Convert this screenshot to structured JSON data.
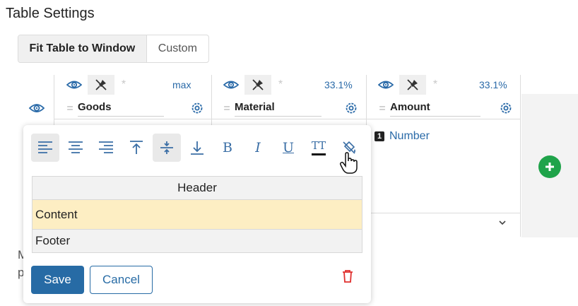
{
  "page": {
    "title": "Table Settings"
  },
  "mode": {
    "fit_label": "Fit Table to Window",
    "custom_label": "Custom",
    "selected": "fit"
  },
  "columns": [
    {
      "name": "Goods",
      "width": "max"
    },
    {
      "name": "Material",
      "width": "33.1%"
    },
    {
      "name": "Amount",
      "width": "33.1%"
    }
  ],
  "column_toolbar": {
    "icons": [
      "eye-icon",
      "pin-off-icon",
      "asterisk-icon"
    ],
    "asterisk": "*"
  },
  "column_head": {
    "drag_glyph": "=",
    "settings_icon": "gear-icon"
  },
  "cells": {
    "number_badge": "1",
    "number_label": "Number"
  },
  "notes": {
    "line1": "M",
    "line2": "p"
  },
  "format_toolbar": {
    "buttons": [
      "align-left-icon",
      "align-center-icon",
      "align-right-icon",
      "align-top-icon",
      "align-middle-icon",
      "align-bottom-icon",
      "bold-icon",
      "italic-icon",
      "underline-icon",
      "text-color-icon",
      "fill-color-icon"
    ],
    "bold": "B",
    "italic": "I",
    "underline": "U",
    "text_size": "TT",
    "active": [
      "align-left",
      "align-middle"
    ]
  },
  "sections": {
    "header": "Header",
    "content": "Content",
    "footer": "Footer"
  },
  "actions": {
    "save": "Save",
    "cancel": "Cancel"
  },
  "colors": {
    "accent": "#276ba5",
    "add": "#1fa34a",
    "delete": "#e0302f",
    "content_bg": "#fdeec3"
  }
}
